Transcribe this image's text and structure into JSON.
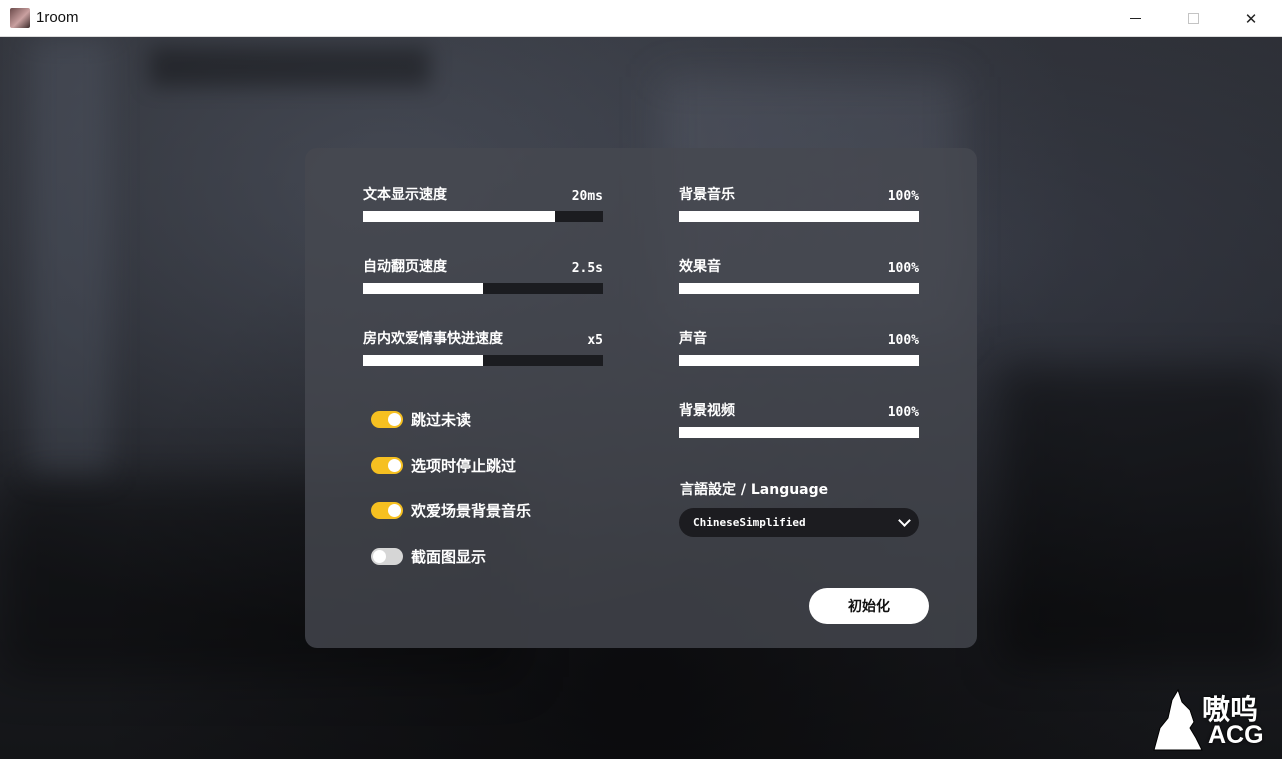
{
  "window": {
    "title": "1room",
    "icon": "app-character-icon",
    "minimize_icon": "minimize-icon",
    "maximize_icon": "maximize-icon",
    "close_glyph": "✕"
  },
  "sliders_left": [
    {
      "label": "文本显示速度",
      "value": "20ms",
      "fill": 0.8
    },
    {
      "label": "自动翻页速度",
      "value": "2.5s",
      "fill": 0.5
    },
    {
      "label": "房内欢爱情事快进速度",
      "value": "x5",
      "fill": 0.5
    }
  ],
  "sliders_right": [
    {
      "label": "背景音乐",
      "value": "100%",
      "fill": 1.0
    },
    {
      "label": "效果音",
      "value": "100%",
      "fill": 1.0
    },
    {
      "label": "声音",
      "value": "100%",
      "fill": 1.0
    },
    {
      "label": "背景视频",
      "value": "100%",
      "fill": 1.0
    }
  ],
  "toggles": [
    {
      "label": "跳过未读",
      "on": true
    },
    {
      "label": "选项时停止跳过",
      "on": true
    },
    {
      "label": "欢爱场景背景音乐",
      "on": true
    },
    {
      "label": "截面图显示",
      "on": false
    }
  ],
  "language": {
    "label": "言語設定 / Language",
    "selected": "ChineseSimplified"
  },
  "reset_button": "初始化",
  "watermark": {
    "top": "嗷呜",
    "bottom": "ACG"
  },
  "colors": {
    "toggle_on": "#f6c021",
    "toggle_off": "#d6d6d6",
    "panel": "#46484f",
    "slider_fill": "#ffffff",
    "slider_track": "#1b1c20"
  }
}
